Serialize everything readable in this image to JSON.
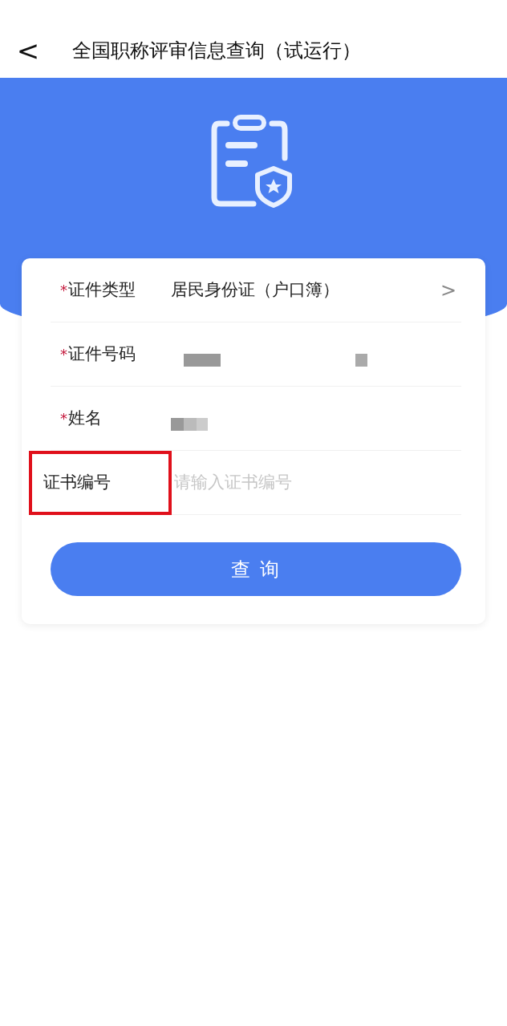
{
  "header": {
    "back": "<",
    "title": "全国职称评审信息查询（试运行）"
  },
  "fields": [
    {
      "kind": "select",
      "label": "证件类型",
      "required": true,
      "highlighted": false,
      "value": "居民身份证（户口簿）",
      "chevron": ">"
    },
    {
      "kind": "redacted",
      "label": "证件号码",
      "required": true,
      "highlighted": false
    },
    {
      "kind": "redacted",
      "label": "姓名",
      "required": true,
      "highlighted": false
    },
    {
      "kind": "input",
      "label": "证书编号",
      "required": false,
      "highlighted": true,
      "placeholder": "请输入证书编号"
    }
  ],
  "required_mark": "*",
  "submit": "查 询"
}
